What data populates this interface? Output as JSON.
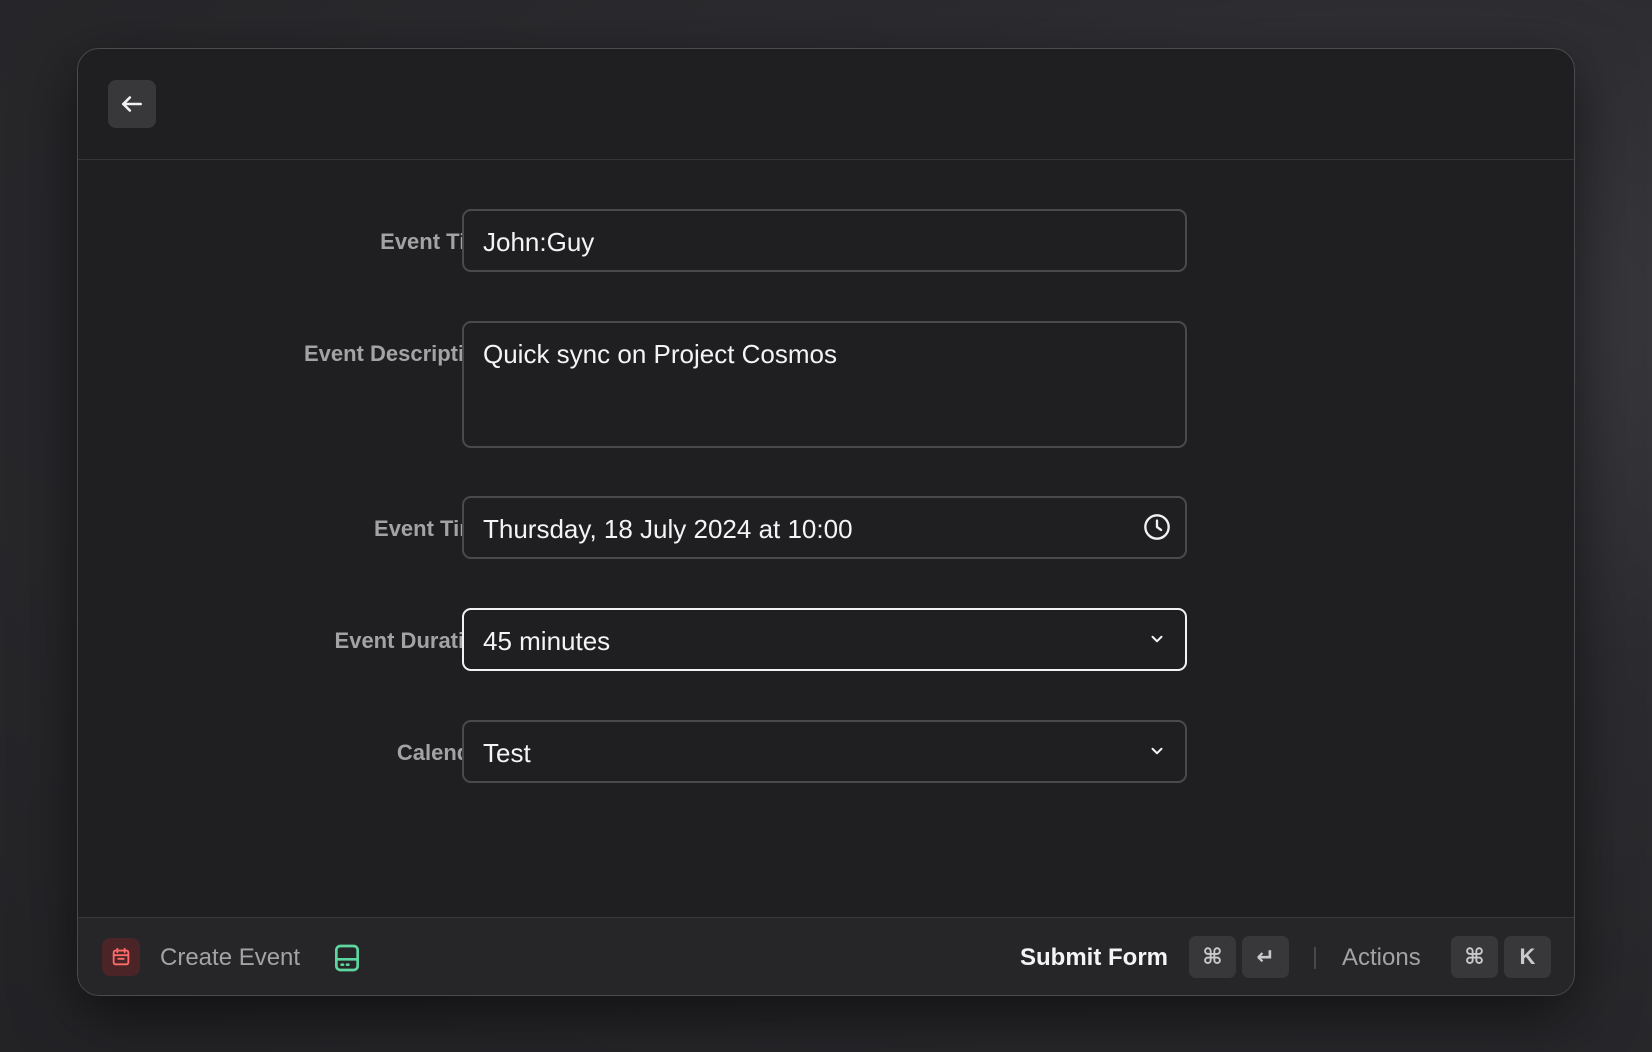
{
  "form": {
    "title_label": "Event Title",
    "title_value": "John:Guy",
    "description_label": "Event Description",
    "description_value": "Quick sync on Project Cosmos",
    "time_label": "Event Time",
    "time_value": "Thursday, 18 July 2024 at 10:00",
    "duration_label": "Event Duration",
    "duration_value": "45 minutes",
    "calendar_label": "Calendar",
    "calendar_value": "Test"
  },
  "footer": {
    "title": "Create Event",
    "submit_label": "Submit Form",
    "submit_key_1": "⌘",
    "submit_key_2": "↵",
    "actions_label": "Actions",
    "actions_key_1": "⌘",
    "actions_key_2": "K"
  },
  "icons": {
    "back": "arrow-left-icon",
    "clock": "clock-icon",
    "chevron": "chevron-down-icon",
    "calendar": "calendar-icon",
    "drive": "hard-drive-icon"
  },
  "colors": {
    "background": "#1f1f21",
    "badge_bg": "#4a2426",
    "badge_icon": "#ff6b6b",
    "drive_icon": "#5ed6a0",
    "focus_border": "#f2f2f2"
  }
}
